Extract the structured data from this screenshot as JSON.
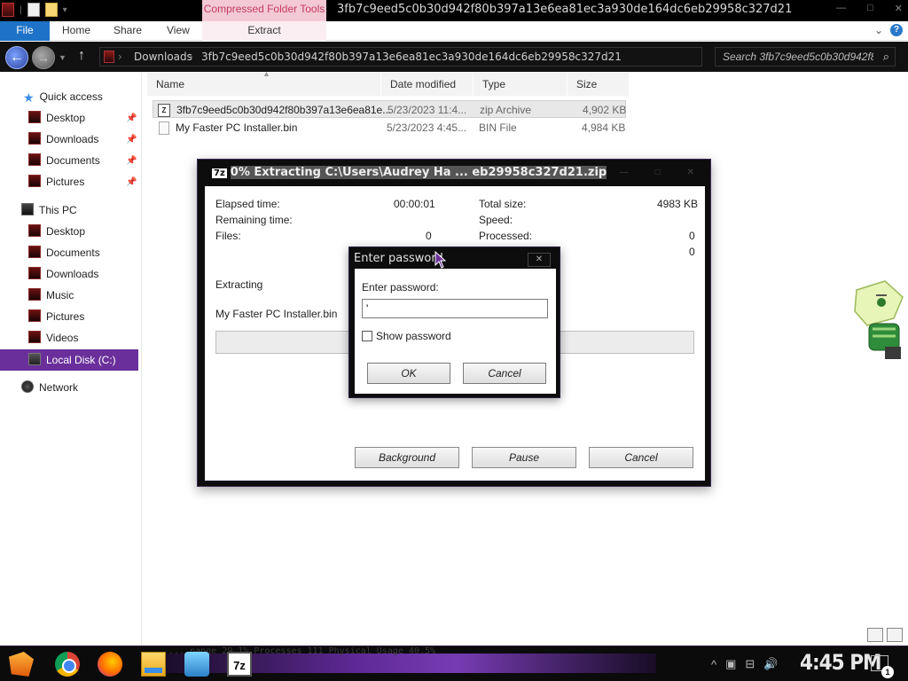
{
  "titlebar": {
    "context_tab": "Compressed Folder Tools",
    "title": "3fb7c9eed5c0b30d942f80b397a13e6ea81ec3a930de164dc6eb29958c327d21"
  },
  "ribbon": {
    "tabs": [
      "File",
      "Home",
      "Share",
      "View"
    ],
    "context_action": "Extract"
  },
  "address": {
    "crumbs": [
      "Downloads",
      "3fb7c9eed5c0b30d942f80b397a13e6ea81ec3a930de164dc6eb29958c327d21"
    ],
    "search_placeholder": "Search 3fb7c9eed5c0b30d942f8..."
  },
  "nav": {
    "quick_access": "Quick access",
    "quick_items": [
      "Desktop",
      "Downloads",
      "Documents",
      "Pictures"
    ],
    "this_pc": "This PC",
    "pc_items": [
      "Desktop",
      "Documents",
      "Downloads",
      "Music",
      "Pictures",
      "Videos"
    ],
    "local_disk": "Local Disk (C:)",
    "network": "Network"
  },
  "file_list": {
    "columns": [
      "Name",
      "Date modified",
      "Type",
      "Size"
    ],
    "rows": [
      {
        "name": "3fb7c9eed5c0b30d942f80b397a13e6ea81e...",
        "date": "5/23/2023 11:4...",
        "type": "zip Archive",
        "size": "4,902 KB"
      },
      {
        "name": "My Faster PC Installer.bin",
        "date": "5/23/2023 4:45...",
        "type": "BIN File",
        "size": "4,984 KB"
      }
    ]
  },
  "progress_dialog": {
    "title_prefix": "7z",
    "title": "0% Extracting C:\\Users\\Audrey Ha ... eb29958c327d21.zip",
    "elapsed_label": "Elapsed time:",
    "elapsed_value": "00:00:01",
    "remaining_label": "Remaining time:",
    "files_label": "Files:",
    "files_value": "0",
    "total_size_label": "Total size:",
    "total_size_value": "4983 KB",
    "speed_label": "Speed:",
    "processed_label": "Processed:",
    "processed_value": "0",
    "extra_value": "0",
    "status": "Extracting",
    "current_file": "My Faster PC Installer.bin",
    "progress": 0,
    "buttons": {
      "background": "Background",
      "pause": "Pause",
      "cancel": "Cancel"
    }
  },
  "password_dialog": {
    "title": "Enter password",
    "label": "Enter password:",
    "value": "'",
    "show_password": "Show password",
    "ok": "OK",
    "cancel": "Cancel"
  },
  "taskbar": {
    "ghost_text": "... nange 29.1%   Processes 111   Physical Usage 40.5%",
    "clock": "4:45 PM",
    "notifications": "1"
  },
  "colors": {
    "accent_purple": "#6a2f9a",
    "file_tab_blue": "#1e73c8",
    "context_tab_pink": "#f3c9d6"
  }
}
